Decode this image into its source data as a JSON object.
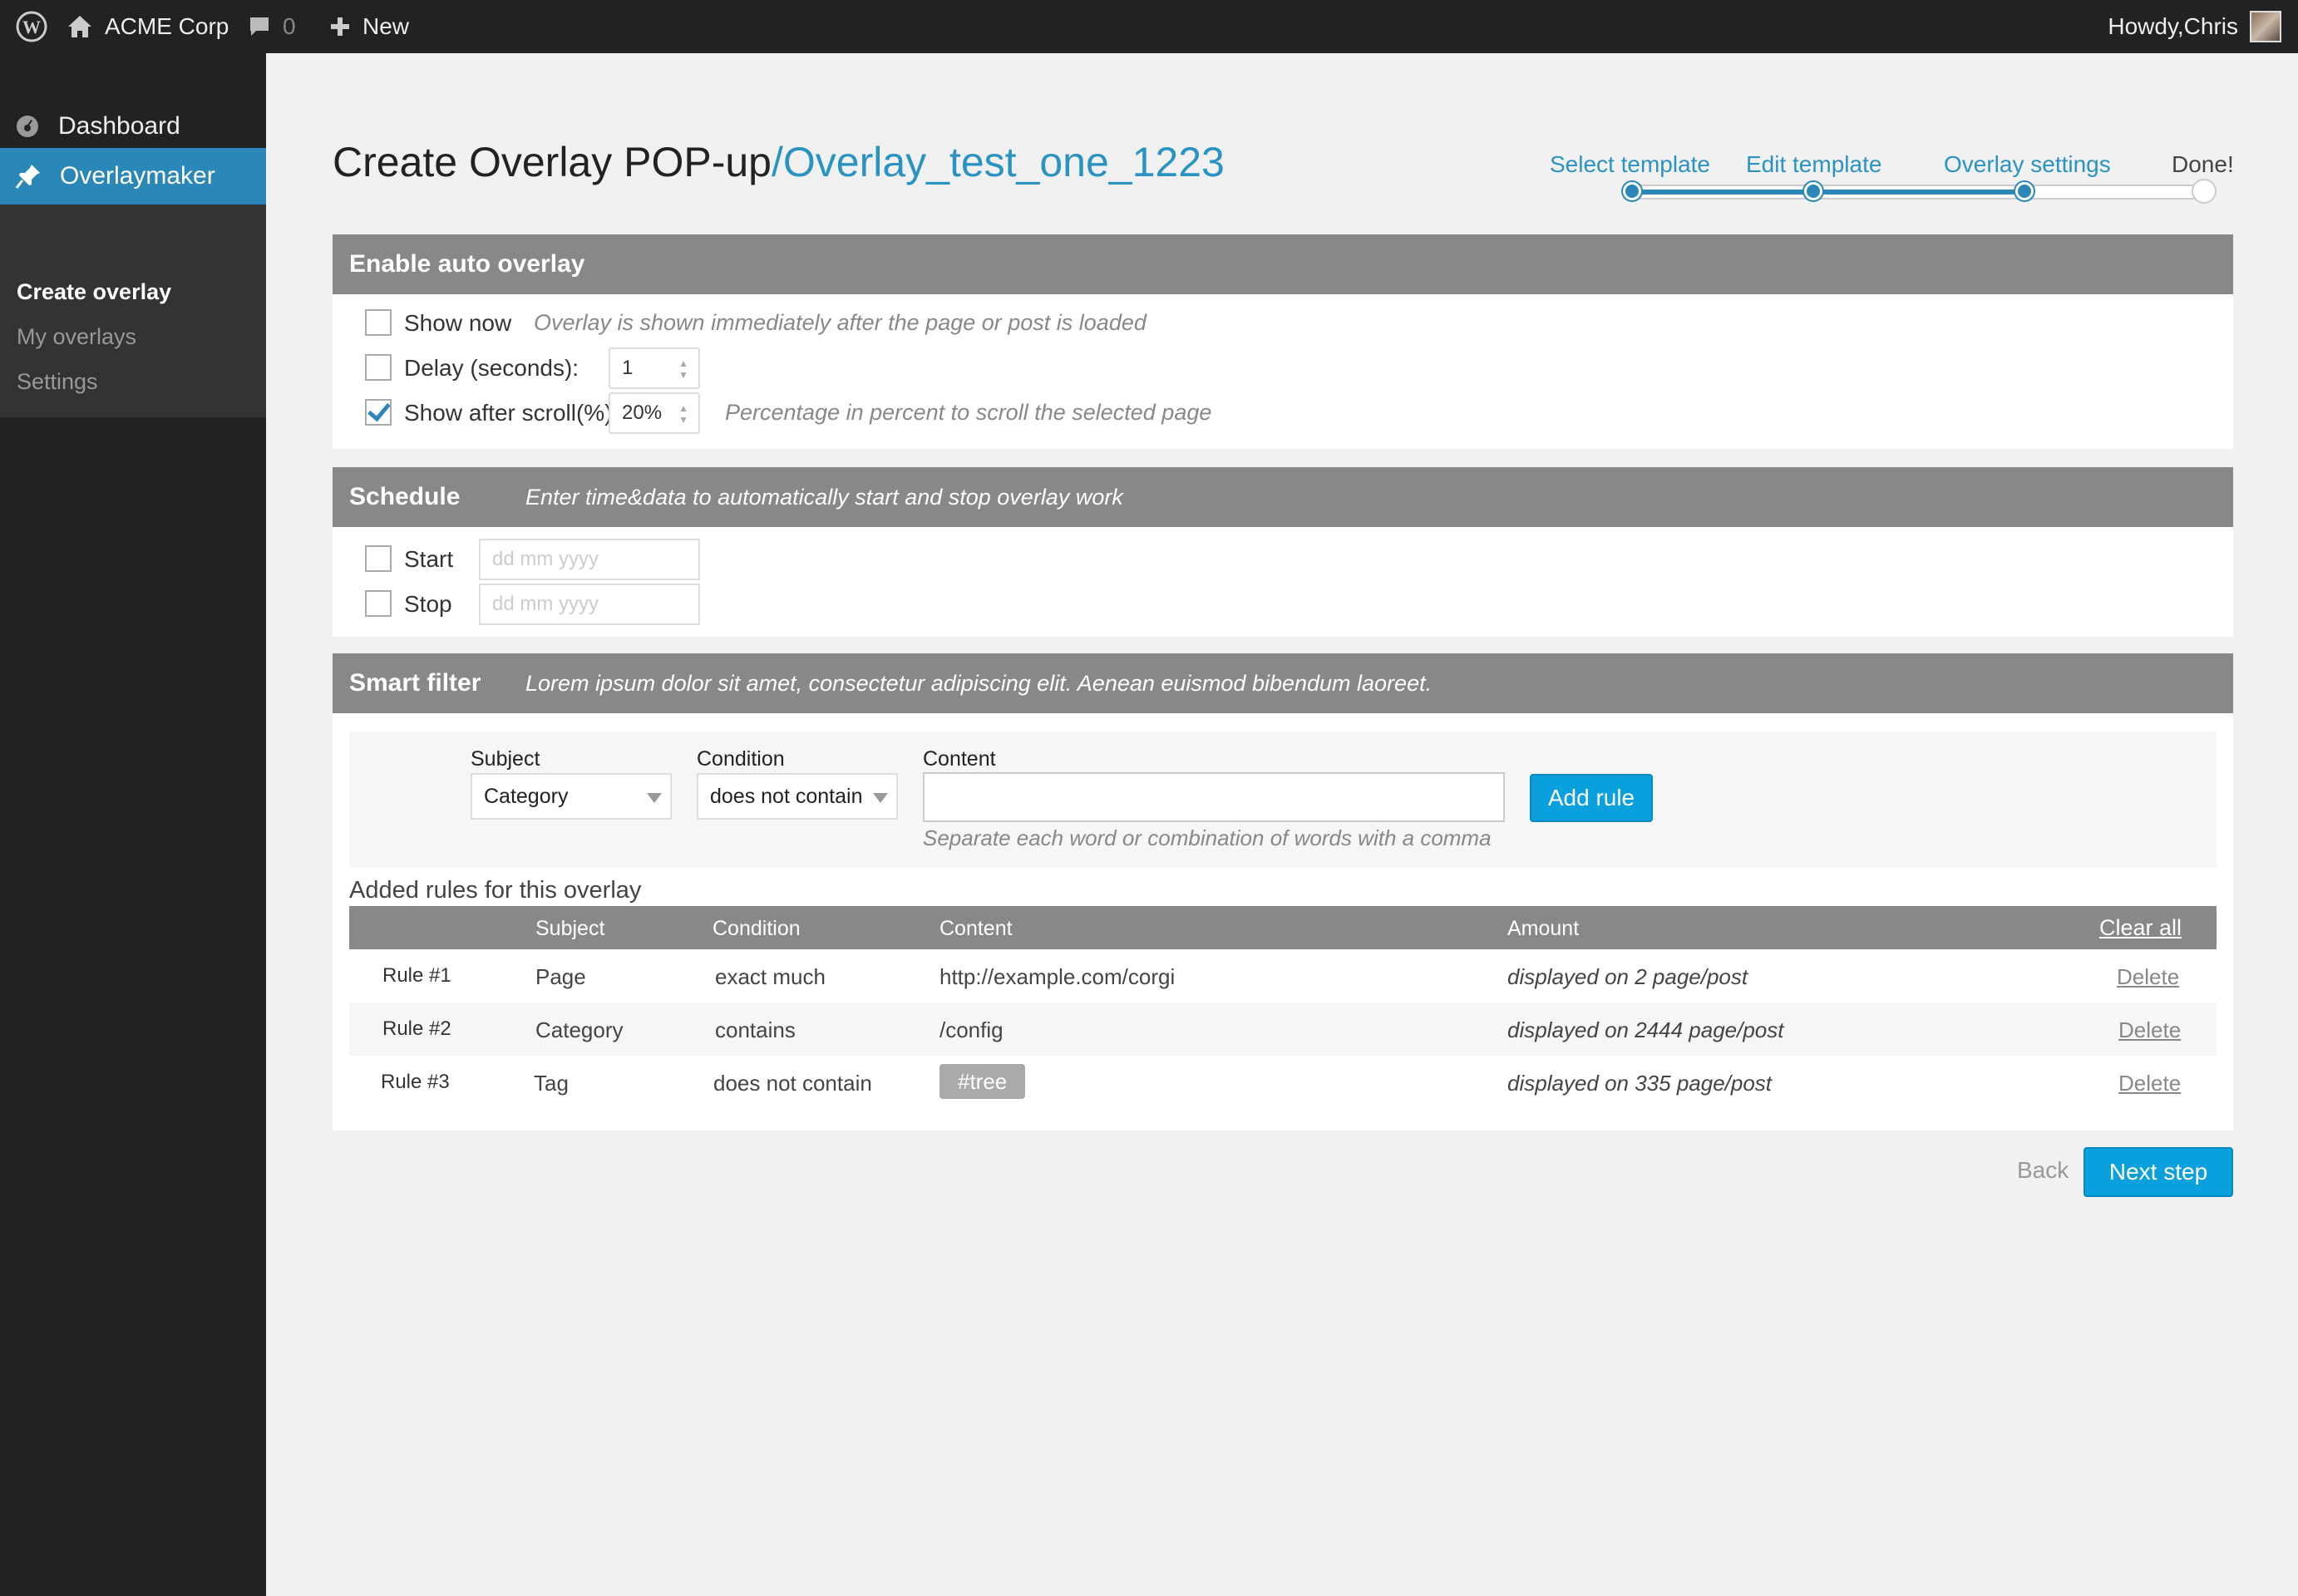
{
  "adminbar": {
    "site_name": "ACME Corp",
    "comments_count": "0",
    "new_label": "New",
    "greeting": "Howdy,Chris"
  },
  "sidebar": {
    "dashboard": "Dashboard",
    "plugin": "Overlaymaker",
    "submenu": [
      "Create overlay",
      "My overlays",
      "Settings"
    ]
  },
  "title": {
    "main": "Create Overlay POP-up",
    "slug": "/Overlay_test_one_1223"
  },
  "steps": {
    "labels": [
      "Select template",
      "Edit template",
      "Overlay settings",
      "Done!"
    ],
    "progress_fraction": 0.75
  },
  "auto_overlay": {
    "heading": "Enable auto overlay",
    "show_now_label": "Show now",
    "show_now_hint": "Overlay is shown immediately after the page or post is loaded",
    "delay_label": "Delay (seconds):",
    "delay_value": "1",
    "scroll_label": "Show after scroll(%):",
    "scroll_value": "20%",
    "scroll_hint": "Percentage in percent to scroll the selected page"
  },
  "schedule": {
    "heading": "Schedule",
    "description": "Enter time&data to automatically start and stop overlay work",
    "start_label": "Start",
    "stop_label": "Stop",
    "date_placeholder": "dd mm yyyy"
  },
  "smart_filter": {
    "heading": "Smart filter",
    "description": "Lorem ipsum dolor sit amet, consectetur adipiscing elit. Aenean euismod bibendum laoreet.",
    "subject_label": "Subject",
    "subject_value": "Category",
    "condition_label": "Condition",
    "condition_value": "does not contain",
    "content_label": "Content",
    "content_hint": "Separate each word or combination of words with a comma",
    "add_rule": "Add rule"
  },
  "rules": {
    "title": "Added rules for this overlay",
    "headers": {
      "subject": "Subject",
      "condition": "Condition",
      "content": "Content",
      "amount": "Amount",
      "clear_all": "Clear all"
    },
    "rows": [
      {
        "rule": "Rule #1",
        "subject": "Page",
        "condition": "exact much",
        "content": "http://example.com/corgi",
        "amount": "displayed on 2 page/post",
        "delete": "Delete"
      },
      {
        "rule": "Rule #2",
        "subject": "Category",
        "condition": "contains",
        "content": "/config",
        "amount": "displayed on 2444 page/post",
        "delete": "Delete"
      },
      {
        "rule": "Rule #3",
        "subject": "Tag",
        "condition": "does not contain",
        "content": "#tree",
        "amount": "displayed on 335 page/post",
        "delete": "Delete"
      }
    ]
  },
  "footer": {
    "back": "Back",
    "next": "Next step"
  }
}
